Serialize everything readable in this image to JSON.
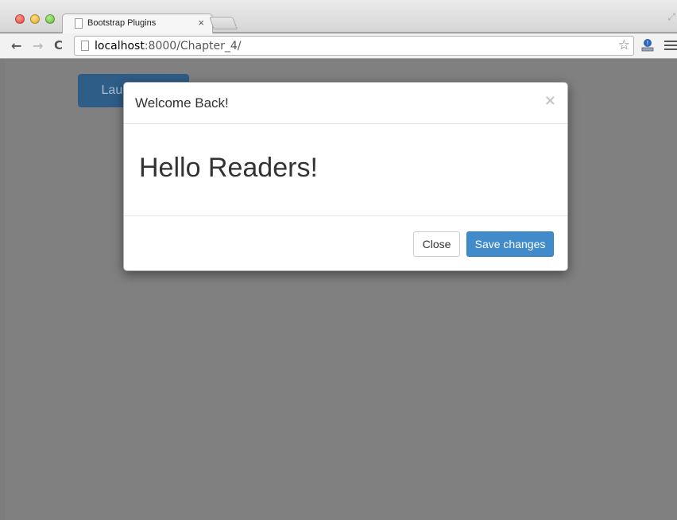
{
  "browser": {
    "tab_title": "Bootstrap Plugins",
    "tab_close": "×",
    "url_host": "localhost",
    "url_rest": ":8000/Chapter_4/",
    "back_icon": "arrow-left-icon",
    "forward_icon": "arrow-right-icon",
    "reload_icon": "reload-icon"
  },
  "page": {
    "launch_button_label": "Launch demo modal"
  },
  "modal": {
    "title": "Welcome Back!",
    "close_symbol": "×",
    "body_heading": "Hello Readers!",
    "close_button_label": "Close",
    "save_button_label": "Save changes"
  },
  "colors": {
    "backdrop": "#808080",
    "primary": "#428bca",
    "launch_button_dimmed": "#2e5d88"
  }
}
